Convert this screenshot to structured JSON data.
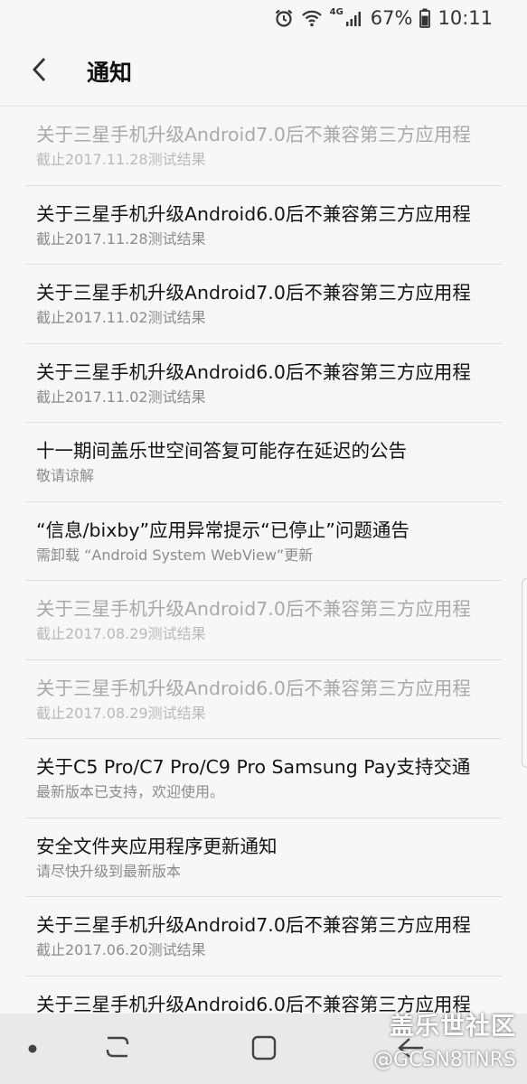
{
  "status_bar": {
    "network": "4G",
    "battery": "67%",
    "time": "10:11",
    "icons": [
      "alarm-icon",
      "wifi-icon",
      "signal-icon",
      "battery-icon"
    ]
  },
  "header": {
    "back_icon": "chevron-left-icon",
    "title": "通知"
  },
  "notifications": [
    {
      "title": "关于三星手机升级Android7.0后不兼容第三方应用程",
      "subtitle": "截止2017.11.28测试结果",
      "read": true
    },
    {
      "title": "关于三星手机升级Android6.0后不兼容第三方应用程",
      "subtitle": "截止2017.11.28测试结果",
      "read": false
    },
    {
      "title": "关于三星手机升级Android7.0后不兼容第三方应用程",
      "subtitle": "截止2017.11.02测试结果",
      "read": false
    },
    {
      "title": "关于三星手机升级Android6.0后不兼容第三方应用程",
      "subtitle": "截止2017.11.02测试结果",
      "read": false
    },
    {
      "title": "十一期间盖乐世空间答复可能存在延迟的公告",
      "subtitle": "敬请谅解",
      "read": false
    },
    {
      "title": "“信息/bixby”应用异常提示“已停止”问题通告",
      "subtitle": "需卸载 “Android System WebView”更新",
      "read": false
    },
    {
      "title": "关于三星手机升级Android7.0后不兼容第三方应用程",
      "subtitle": "截止2017.08.29测试结果",
      "read": true
    },
    {
      "title": "关于三星手机升级Android6.0后不兼容第三方应用程",
      "subtitle": "截止2017.08.29测试结果",
      "read": true
    },
    {
      "title": "关于C5 Pro/C7 Pro/C9 Pro Samsung Pay支持交通",
      "subtitle": "最新版本已支持，欢迎使用。",
      "read": false
    },
    {
      "title": "安全文件夹应用程序更新通知",
      "subtitle": "请尽快升级到最新版本",
      "read": false
    },
    {
      "title": "关于三星手机升级Android7.0后不兼容第三方应用程",
      "subtitle": "截止2017.06.20测试结果",
      "read": false
    },
    {
      "title": "关于三星手机升级Android6.0后不兼容第三方应用程",
      "subtitle": "",
      "read": false
    }
  ],
  "nav_bar": {
    "icons": [
      "dot-icon",
      "recents-icon",
      "home-icon",
      "back-icon"
    ]
  },
  "watermark": {
    "line1": "盖乐世社区",
    "line2": "@GCSN8TNRS"
  }
}
